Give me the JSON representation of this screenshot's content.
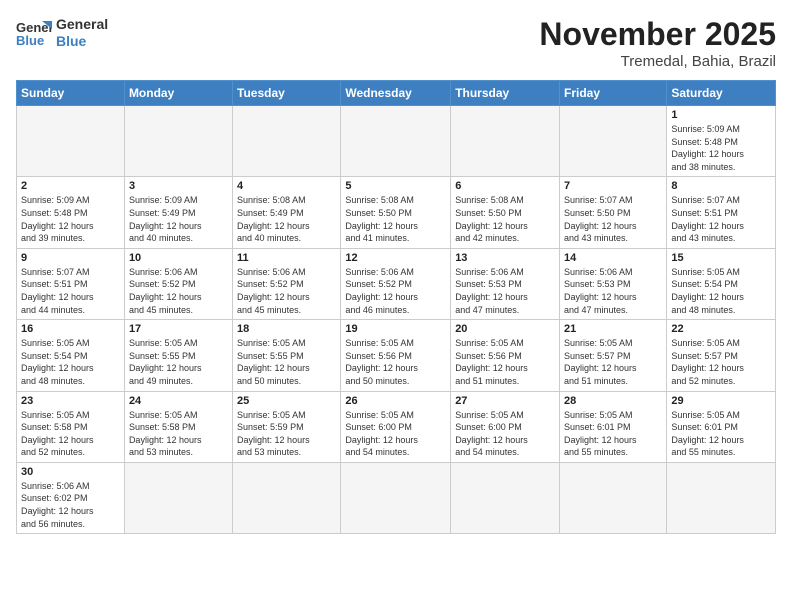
{
  "header": {
    "logo_general": "General",
    "logo_blue": "Blue",
    "month_title": "November 2025",
    "location": "Tremedal, Bahia, Brazil"
  },
  "days_of_week": [
    "Sunday",
    "Monday",
    "Tuesday",
    "Wednesday",
    "Thursday",
    "Friday",
    "Saturday"
  ],
  "weeks": [
    [
      {
        "day": "",
        "info": ""
      },
      {
        "day": "",
        "info": ""
      },
      {
        "day": "",
        "info": ""
      },
      {
        "day": "",
        "info": ""
      },
      {
        "day": "",
        "info": ""
      },
      {
        "day": "",
        "info": ""
      },
      {
        "day": "1",
        "info": "Sunrise: 5:09 AM\nSunset: 5:48 PM\nDaylight: 12 hours\nand 38 minutes."
      }
    ],
    [
      {
        "day": "2",
        "info": "Sunrise: 5:09 AM\nSunset: 5:48 PM\nDaylight: 12 hours\nand 39 minutes."
      },
      {
        "day": "3",
        "info": "Sunrise: 5:09 AM\nSunset: 5:49 PM\nDaylight: 12 hours\nand 40 minutes."
      },
      {
        "day": "4",
        "info": "Sunrise: 5:08 AM\nSunset: 5:49 PM\nDaylight: 12 hours\nand 40 minutes."
      },
      {
        "day": "5",
        "info": "Sunrise: 5:08 AM\nSunset: 5:50 PM\nDaylight: 12 hours\nand 41 minutes."
      },
      {
        "day": "6",
        "info": "Sunrise: 5:08 AM\nSunset: 5:50 PM\nDaylight: 12 hours\nand 42 minutes."
      },
      {
        "day": "7",
        "info": "Sunrise: 5:07 AM\nSunset: 5:50 PM\nDaylight: 12 hours\nand 43 minutes."
      },
      {
        "day": "8",
        "info": "Sunrise: 5:07 AM\nSunset: 5:51 PM\nDaylight: 12 hours\nand 43 minutes."
      }
    ],
    [
      {
        "day": "9",
        "info": "Sunrise: 5:07 AM\nSunset: 5:51 PM\nDaylight: 12 hours\nand 44 minutes."
      },
      {
        "day": "10",
        "info": "Sunrise: 5:06 AM\nSunset: 5:52 PM\nDaylight: 12 hours\nand 45 minutes."
      },
      {
        "day": "11",
        "info": "Sunrise: 5:06 AM\nSunset: 5:52 PM\nDaylight: 12 hours\nand 45 minutes."
      },
      {
        "day": "12",
        "info": "Sunrise: 5:06 AM\nSunset: 5:52 PM\nDaylight: 12 hours\nand 46 minutes."
      },
      {
        "day": "13",
        "info": "Sunrise: 5:06 AM\nSunset: 5:53 PM\nDaylight: 12 hours\nand 47 minutes."
      },
      {
        "day": "14",
        "info": "Sunrise: 5:06 AM\nSunset: 5:53 PM\nDaylight: 12 hours\nand 47 minutes."
      },
      {
        "day": "15",
        "info": "Sunrise: 5:05 AM\nSunset: 5:54 PM\nDaylight: 12 hours\nand 48 minutes."
      }
    ],
    [
      {
        "day": "16",
        "info": "Sunrise: 5:05 AM\nSunset: 5:54 PM\nDaylight: 12 hours\nand 48 minutes."
      },
      {
        "day": "17",
        "info": "Sunrise: 5:05 AM\nSunset: 5:55 PM\nDaylight: 12 hours\nand 49 minutes."
      },
      {
        "day": "18",
        "info": "Sunrise: 5:05 AM\nSunset: 5:55 PM\nDaylight: 12 hours\nand 50 minutes."
      },
      {
        "day": "19",
        "info": "Sunrise: 5:05 AM\nSunset: 5:56 PM\nDaylight: 12 hours\nand 50 minutes."
      },
      {
        "day": "20",
        "info": "Sunrise: 5:05 AM\nSunset: 5:56 PM\nDaylight: 12 hours\nand 51 minutes."
      },
      {
        "day": "21",
        "info": "Sunrise: 5:05 AM\nSunset: 5:57 PM\nDaylight: 12 hours\nand 51 minutes."
      },
      {
        "day": "22",
        "info": "Sunrise: 5:05 AM\nSunset: 5:57 PM\nDaylight: 12 hours\nand 52 minutes."
      }
    ],
    [
      {
        "day": "23",
        "info": "Sunrise: 5:05 AM\nSunset: 5:58 PM\nDaylight: 12 hours\nand 52 minutes."
      },
      {
        "day": "24",
        "info": "Sunrise: 5:05 AM\nSunset: 5:58 PM\nDaylight: 12 hours\nand 53 minutes."
      },
      {
        "day": "25",
        "info": "Sunrise: 5:05 AM\nSunset: 5:59 PM\nDaylight: 12 hours\nand 53 minutes."
      },
      {
        "day": "26",
        "info": "Sunrise: 5:05 AM\nSunset: 6:00 PM\nDaylight: 12 hours\nand 54 minutes."
      },
      {
        "day": "27",
        "info": "Sunrise: 5:05 AM\nSunset: 6:00 PM\nDaylight: 12 hours\nand 54 minutes."
      },
      {
        "day": "28",
        "info": "Sunrise: 5:05 AM\nSunset: 6:01 PM\nDaylight: 12 hours\nand 55 minutes."
      },
      {
        "day": "29",
        "info": "Sunrise: 5:05 AM\nSunset: 6:01 PM\nDaylight: 12 hours\nand 55 minutes."
      }
    ],
    [
      {
        "day": "30",
        "info": "Sunrise: 5:06 AM\nSunset: 6:02 PM\nDaylight: 12 hours\nand 56 minutes."
      },
      {
        "day": "",
        "info": ""
      },
      {
        "day": "",
        "info": ""
      },
      {
        "day": "",
        "info": ""
      },
      {
        "day": "",
        "info": ""
      },
      {
        "day": "",
        "info": ""
      },
      {
        "day": "",
        "info": ""
      }
    ]
  ]
}
